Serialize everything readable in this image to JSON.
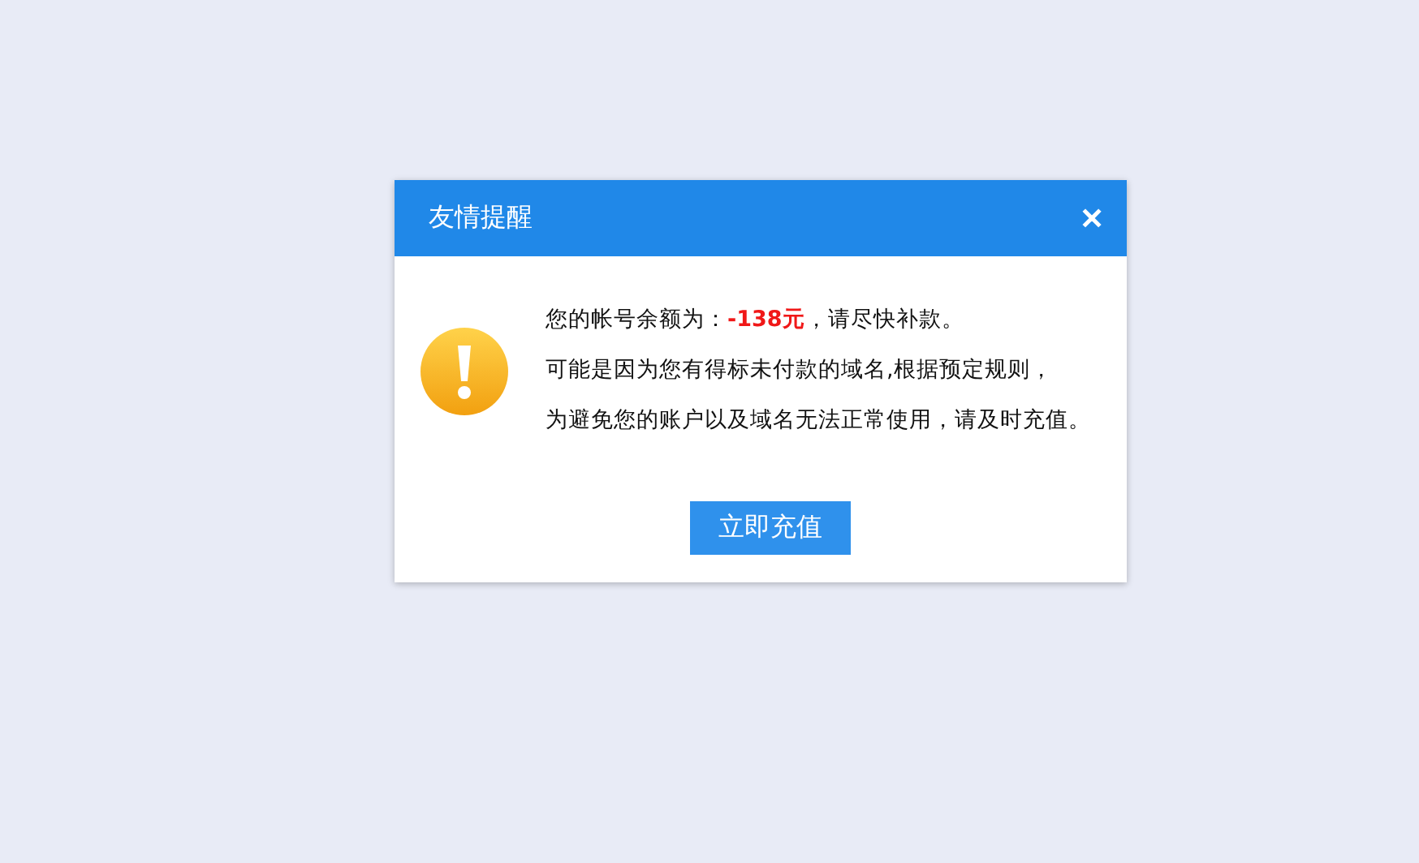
{
  "dialog": {
    "title": "友情提醒",
    "close": "✕",
    "lines": [
      "您的帐号余额为：**-138元**，请尽快补款。",
      "可能是因为您有得标未付款的域名,根据预定规则，",
      "为避免您的账户以及域名无法正常使用，请及时充值。"
    ],
    "button": "立即充值"
  }
}
